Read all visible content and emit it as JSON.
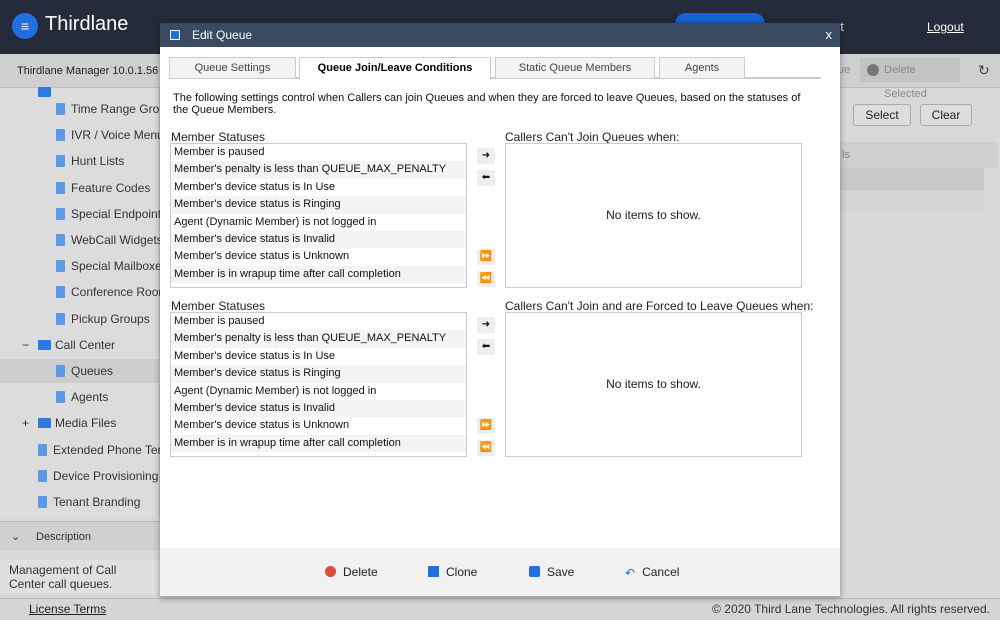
{
  "header": {
    "brand": "Thirdlane",
    "user_fragment": "ot",
    "logout": "Logout"
  },
  "subbar": {
    "version": "Thirdlane Manager 10.0.1.56",
    "queue_fragment": "ue",
    "delete_selected": "Delete Selected"
  },
  "bg_buttons": {
    "select": "Select",
    "clear": "Clear",
    "grid_header_fragment": "ls"
  },
  "sidebar": {
    "items": [
      {
        "label": "Time Range Groups",
        "type": "doc"
      },
      {
        "label": "IVR / Voice Menus",
        "type": "doc"
      },
      {
        "label": "Hunt Lists",
        "type": "doc"
      },
      {
        "label": "Feature Codes",
        "type": "doc"
      },
      {
        "label": "Special Endpoints",
        "type": "doc"
      },
      {
        "label": "WebCall Widgets",
        "type": "doc"
      },
      {
        "label": "Special Mailboxes",
        "type": "doc"
      },
      {
        "label": "Conference Rooms",
        "type": "doc"
      },
      {
        "label": "Pickup Groups",
        "type": "doc"
      },
      {
        "label": "Call Center",
        "type": "folder",
        "expander": "−"
      },
      {
        "label": "Queues",
        "type": "doc",
        "selected": true
      },
      {
        "label": "Agents",
        "type": "doc"
      },
      {
        "label": "Media Files",
        "type": "folder",
        "expander": "+"
      },
      {
        "label": "Extended Phone Templates",
        "type": "doc"
      },
      {
        "label": "Device Provisioning",
        "type": "doc"
      },
      {
        "label": "Tenant Branding",
        "type": "doc"
      }
    ]
  },
  "description": {
    "title": "Description",
    "text": "Management of Call Center call queues."
  },
  "footer": {
    "license": "License Terms",
    "copyright": "© 2020 Third Lane Technologies. All rights reserved."
  },
  "modal": {
    "title": "Edit Queue",
    "close": "x",
    "tabs": [
      {
        "label": "Queue Settings"
      },
      {
        "label": "Queue Join/Leave Conditions",
        "active": true
      },
      {
        "label": "Static Queue Members"
      },
      {
        "label": "Agents"
      }
    ],
    "intro": "The following settings control when Callers can join Queues and when they are forced to leave Queues, based on the statuses of the Queue Members.",
    "sections": [
      {
        "source_label": "Member Statuses",
        "target_label": "Callers Can't Join Queues when:",
        "empty": "No items to show."
      },
      {
        "source_label": "Member Statuses",
        "target_label": "Callers Can't Join and are Forced to Leave Queues when:",
        "empty": "No items to show."
      }
    ],
    "statuses": [
      "Member is paused",
      "Member's penalty is less than QUEUE_MAX_PENALTY",
      "Member's device status is In Use",
      "Member's device status is Ringing",
      "Agent (Dynamic Member) is not logged in",
      "Member's device status is Invalid",
      "Member's device status is Unknown",
      "Member is in wrapup time after call completion"
    ],
    "arrows": {
      "add": "➜",
      "remove": "⬅",
      "add_all": "⏩",
      "remove_all": "⏪"
    },
    "actions": {
      "delete": "Delete",
      "clone": "Clone",
      "save": "Save",
      "cancel": "Cancel"
    }
  },
  "colors": {
    "header": "#252b3a",
    "modal_title": "#3a4a60",
    "accent": "#1e6fe0",
    "delete": "#e04a3a"
  }
}
